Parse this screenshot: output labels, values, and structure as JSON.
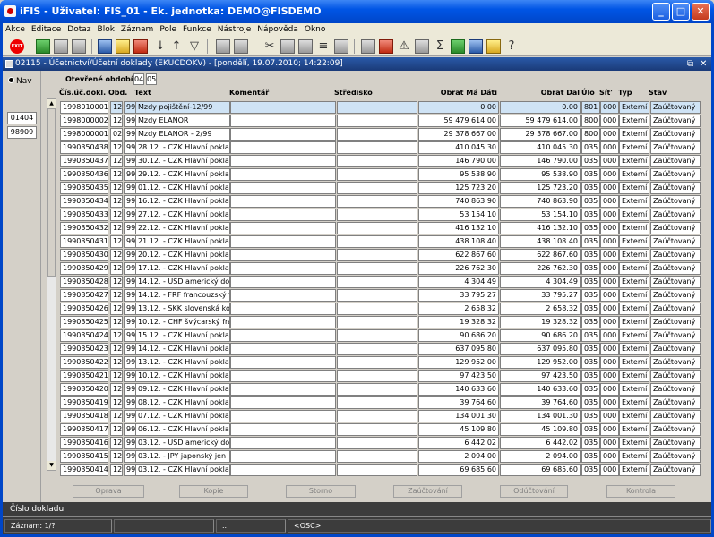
{
  "window": {
    "title": "iFIS - Uživatel: FIS_01 - Ek. jednotka: DEMO@FISDEMO",
    "controls": {
      "minimize": "_",
      "maximize": "□",
      "close": "✕"
    }
  },
  "menu": [
    "Akce",
    "Editace",
    "Dotaz",
    "Blok",
    "Záznam",
    "Pole",
    "Funkce",
    "Nástroje",
    "Nápověda",
    "Okno"
  ],
  "toolbar": {
    "exit_label": "EXIT",
    "icons": [
      "add-record-icon",
      "save-icon",
      "delete-icon",
      "cancel-icon",
      "enter-query-icon",
      "execute-query-icon",
      "sort-asc-icon",
      "sort-desc-icon",
      "filter-icon",
      "print-icon",
      "print-preview-icon",
      "cut-icon",
      "copy-icon",
      "paste-icon",
      "list-icon",
      "calculator-icon",
      "bug-icon",
      "warning-icon",
      "tool-icon",
      "sum-icon",
      "excel-icon",
      "export-icon",
      "help-icon",
      "question-icon"
    ]
  },
  "inner_window": {
    "title": "02115 - Účetnictví/Účetní doklady (EKUCDOKV) - [pondělí, 19.07.2010; 14:22:09]",
    "controls": {
      "restore": "⧉",
      "close": "✕"
    }
  },
  "nav": {
    "label": "Nav",
    "buttons": [
      "01404",
      "98909"
    ]
  },
  "period": {
    "label": "Otevřené období",
    "values": [
      "04",
      "05"
    ]
  },
  "columns": {
    "cislo": "Čís.úč.dokl.",
    "obd": "Obd.",
    "text": "Text",
    "komentar": "Komentář",
    "stredisko": "Středisko",
    "obrat_md": "Obrat Má Dáti",
    "obrat_dal": "Obrat Dal",
    "ulo": "Úlo",
    "sit": "Sít'",
    "typ": "Typ",
    "stav": "Stav"
  },
  "rows": [
    {
      "cislo": "1998010001",
      "obd": "12",
      "c": "99",
      "text": "Mzdy pojištění-12/99",
      "md": "0.00",
      "dal": "0.00",
      "ulo": "801",
      "sit": "000",
      "typ": "Externí",
      "stav": "Zaúčtovaný"
    },
    {
      "cislo": "1998000002",
      "obd": "12",
      "c": "99",
      "text": "Mzdy ELANOR",
      "md": "59 479 614.00",
      "dal": "59 479 614.00",
      "ulo": "800",
      "sit": "000",
      "typ": "Externí",
      "stav": "Zaúčtovaný"
    },
    {
      "cislo": "1998000001",
      "obd": "02",
      "c": "99",
      "text": "Mzdy ELANOR - 2/99",
      "md": "29 378 667.00",
      "dal": "29 378 667.00",
      "ulo": "800",
      "sit": "000",
      "typ": "Externí",
      "stav": "Zaúčtovaný"
    },
    {
      "cislo": "1990350438",
      "obd": "12",
      "c": "99",
      "text": "28.12. - CZK Hlavní poklad",
      "md": "410 045.30",
      "dal": "410 045.30",
      "ulo": "035",
      "sit": "000",
      "typ": "Externí",
      "stav": "Zaúčtovaný"
    },
    {
      "cislo": "1990350437",
      "obd": "12",
      "c": "99",
      "text": "30.12. - CZK Hlavní poklad",
      "md": "146 790.00",
      "dal": "146 790.00",
      "ulo": "035",
      "sit": "000",
      "typ": "Externí",
      "stav": "Zaúčtovaný"
    },
    {
      "cislo": "1990350436",
      "obd": "12",
      "c": "99",
      "text": "29.12. - CZK Hlavní poklad",
      "md": "95 538.90",
      "dal": "95 538.90",
      "ulo": "035",
      "sit": "000",
      "typ": "Externí",
      "stav": "Zaúčtovaný"
    },
    {
      "cislo": "1990350435",
      "obd": "12",
      "c": "99",
      "text": "01.12. - CZK Hlavní poklad",
      "md": "125 723.20",
      "dal": "125 723.20",
      "ulo": "035",
      "sit": "000",
      "typ": "Externí",
      "stav": "Zaúčtovaný"
    },
    {
      "cislo": "1990350434",
      "obd": "12",
      "c": "99",
      "text": "16.12. - CZK Hlavní poklad",
      "md": "740 863.90",
      "dal": "740 863.90",
      "ulo": "035",
      "sit": "000",
      "typ": "Externí",
      "stav": "Zaúčtovaný"
    },
    {
      "cislo": "1990350433",
      "obd": "12",
      "c": "99",
      "text": "27.12. - CZK Hlavní poklad",
      "md": "53 154.10",
      "dal": "53 154.10",
      "ulo": "035",
      "sit": "000",
      "typ": "Externí",
      "stav": "Zaúčtovaný"
    },
    {
      "cislo": "1990350432",
      "obd": "12",
      "c": "99",
      "text": "22.12. - CZK Hlavní poklad",
      "md": "416 132.10",
      "dal": "416 132.10",
      "ulo": "035",
      "sit": "000",
      "typ": "Externí",
      "stav": "Zaúčtovaný"
    },
    {
      "cislo": "1990350431",
      "obd": "12",
      "c": "99",
      "text": "21.12. - CZK Hlavní poklad",
      "md": "438 108.40",
      "dal": "438 108.40",
      "ulo": "035",
      "sit": "000",
      "typ": "Externí",
      "stav": "Zaúčtovaný"
    },
    {
      "cislo": "1990350430",
      "obd": "12",
      "c": "99",
      "text": "20.12. - CZK Hlavní poklad",
      "md": "622 867.60",
      "dal": "622 867.60",
      "ulo": "035",
      "sit": "000",
      "typ": "Externí",
      "stav": "Zaúčtovaný"
    },
    {
      "cislo": "1990350429",
      "obd": "12",
      "c": "99",
      "text": "17.12. - CZK Hlavní poklad",
      "md": "226 762.30",
      "dal": "226 762.30",
      "ulo": "035",
      "sit": "000",
      "typ": "Externí",
      "stav": "Zaúčtovaný"
    },
    {
      "cislo": "1990350428",
      "obd": "12",
      "c": "99",
      "text": "14.12. - USD americký dola",
      "md": "4 304.49",
      "dal": "4 304.49",
      "ulo": "035",
      "sit": "000",
      "typ": "Externí",
      "stav": "Zaúčtovaný"
    },
    {
      "cislo": "1990350427",
      "obd": "12",
      "c": "99",
      "text": "14.12. - FRF francouzský f",
      "md": "33 795.27",
      "dal": "33 795.27",
      "ulo": "035",
      "sit": "000",
      "typ": "Externí",
      "stav": "Zaúčtovaný"
    },
    {
      "cislo": "1990350426",
      "obd": "12",
      "c": "99",
      "text": "13.12. - SKK slovenská kor",
      "md": "2 658.32",
      "dal": "2 658.32",
      "ulo": "035",
      "sit": "000",
      "typ": "Externí",
      "stav": "Zaúčtovaný"
    },
    {
      "cislo": "1990350425",
      "obd": "12",
      "c": "99",
      "text": "10.12. - CHF švýcarský fra",
      "md": "19 328.32",
      "dal": "19 328.32",
      "ulo": "035",
      "sit": "000",
      "typ": "Externí",
      "stav": "Zaúčtovaný"
    },
    {
      "cislo": "1990350424",
      "obd": "12",
      "c": "99",
      "text": "15.12. - CZK Hlavní poklad",
      "md": "90 686.20",
      "dal": "90 686.20",
      "ulo": "035",
      "sit": "000",
      "typ": "Externí",
      "stav": "Zaúčtovaný"
    },
    {
      "cislo": "1990350423",
      "obd": "12",
      "c": "99",
      "text": "14.12. - CZK Hlavní poklad",
      "md": "637 095.80",
      "dal": "637 095.80",
      "ulo": "035",
      "sit": "000",
      "typ": "Externí",
      "stav": "Zaúčtovaný"
    },
    {
      "cislo": "1990350422",
      "obd": "12",
      "c": "99",
      "text": "13.12. - CZK Hlavní poklad",
      "md": "129 952.00",
      "dal": "129 952.00",
      "ulo": "035",
      "sit": "000",
      "typ": "Externí",
      "stav": "Zaúčtovaný"
    },
    {
      "cislo": "1990350421",
      "obd": "12",
      "c": "99",
      "text": "10.12. - CZK Hlavní poklad",
      "md": "97 423.50",
      "dal": "97 423.50",
      "ulo": "035",
      "sit": "000",
      "typ": "Externí",
      "stav": "Zaúčtovaný"
    },
    {
      "cislo": "1990350420",
      "obd": "12",
      "c": "99",
      "text": "09.12. - CZK Hlavní poklad",
      "md": "140 633.60",
      "dal": "140 633.60",
      "ulo": "035",
      "sit": "000",
      "typ": "Externí",
      "stav": "Zaúčtovaný"
    },
    {
      "cislo": "1990350419",
      "obd": "12",
      "c": "99",
      "text": "08.12. - CZK Hlavní poklad",
      "md": "39 764.60",
      "dal": "39 764.60",
      "ulo": "035",
      "sit": "000",
      "typ": "Externí",
      "stav": "Zaúčtovaný"
    },
    {
      "cislo": "1990350418",
      "obd": "12",
      "c": "99",
      "text": "07.12. - CZK Hlavní poklad",
      "md": "134 001.30",
      "dal": "134 001.30",
      "ulo": "035",
      "sit": "000",
      "typ": "Externí",
      "stav": "Zaúčtovaný"
    },
    {
      "cislo": "1990350417",
      "obd": "12",
      "c": "99",
      "text": "06.12. - CZK Hlavní poklad",
      "md": "45 109.80",
      "dal": "45 109.80",
      "ulo": "035",
      "sit": "000",
      "typ": "Externí",
      "stav": "Zaúčtovaný"
    },
    {
      "cislo": "1990350416",
      "obd": "12",
      "c": "99",
      "text": "03.12. - USD americký dola",
      "md": "6 442.02",
      "dal": "6 442.02",
      "ulo": "035",
      "sit": "000",
      "typ": "Externí",
      "stav": "Zaúčtovaný"
    },
    {
      "cislo": "1990350415",
      "obd": "12",
      "c": "99",
      "text": "03.12. - JPY japonský jen",
      "md": "2 094.00",
      "dal": "2 094.00",
      "ulo": "035",
      "sit": "000",
      "typ": "Externí",
      "stav": "Zaúčtovaný"
    },
    {
      "cislo": "1990350414",
      "obd": "12",
      "c": "99",
      "text": "03.12. - CZK Hlavní poklad",
      "md": "69 685.60",
      "dal": "69 685.60",
      "ulo": "035",
      "sit": "000",
      "typ": "Externí",
      "stav": "Zaúčtovaný"
    }
  ],
  "actions": [
    "Oprava",
    "Kopie",
    "Storno",
    "Zaúčtování",
    "Odúčtování",
    "Kontrola"
  ],
  "status": {
    "hint": "Číslo dokladu",
    "record": "Záznam: 1/?",
    "middle": "...",
    "mode": "<OSC>"
  },
  "colors": {
    "xp_blue": "#0055e5",
    "selected_row": "#cfe3f5",
    "status_bg": "#3c3c3c"
  }
}
